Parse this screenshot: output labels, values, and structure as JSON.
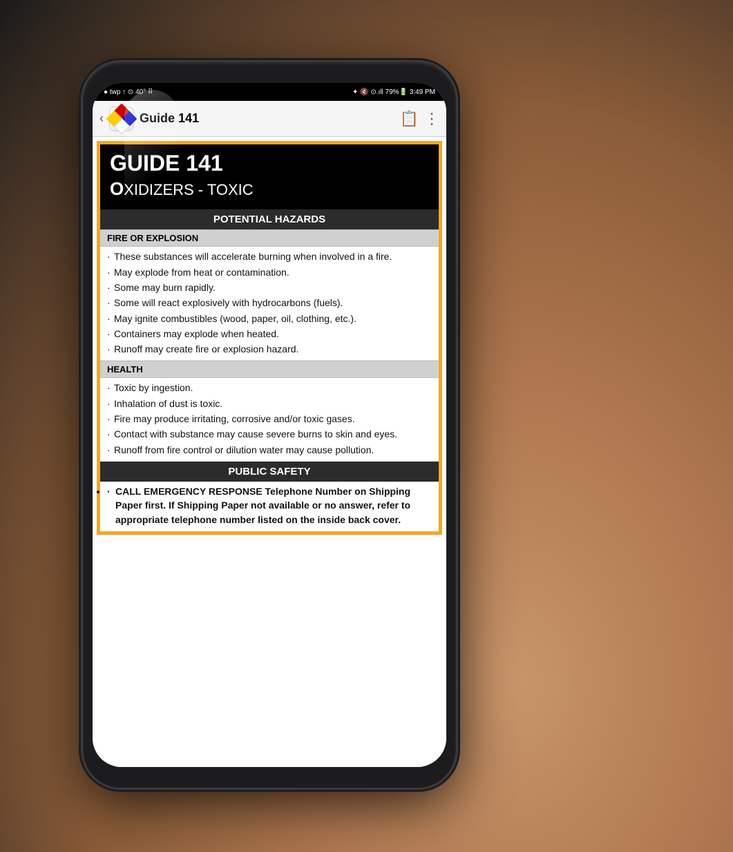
{
  "scene": {
    "background": "dark"
  },
  "status_bar": {
    "left_icons": "● twp ↑ ⊙ 40° ⠿",
    "right_icons": "✦ 🔇 ⊙.ıll 79%🔋 3:49 PM"
  },
  "toolbar": {
    "back_icon": "‹",
    "title": "Guide 141",
    "book_icon": "📖",
    "more_icon": "⋮"
  },
  "guide": {
    "number": "GUIDE 141",
    "subtitle": "Oxidizers - Toxic",
    "sections": [
      {
        "id": "potential_hazards",
        "header": "POTENTIAL HAZARDS",
        "subsections": [
          {
            "id": "fire_explosion",
            "label": "FIRE OR EXPLOSION",
            "items": [
              "These substances will accelerate burning when involved in a fire.",
              "May explode from heat or contamination.",
              "Some may burn rapidly.",
              "Some will react explosively with hydrocarbons (fuels).",
              "May ignite combustibles (wood, paper, oil, clothing, etc.).",
              "Containers may explode when heated.",
              "Runoff may create fire or explosion hazard."
            ]
          },
          {
            "id": "health",
            "label": "HEALTH",
            "items": [
              "Toxic by ingestion.",
              "Inhalation of dust is toxic.",
              "Fire may produce irritating, corrosive and/or toxic gases.",
              "Contact with substance may cause severe burns to skin and eyes.",
              "Runoff from fire control or dilution water may cause pollution."
            ]
          }
        ]
      },
      {
        "id": "public_safety",
        "header": "PUBLIC SAFETY",
        "items": [
          "CALL EMERGENCY RESPONSE Telephone Number on Shipping Paper first. If Shipping Paper not available or no answer, refer to appropriate telephone number listed on the inside back cover."
        ]
      }
    ]
  }
}
